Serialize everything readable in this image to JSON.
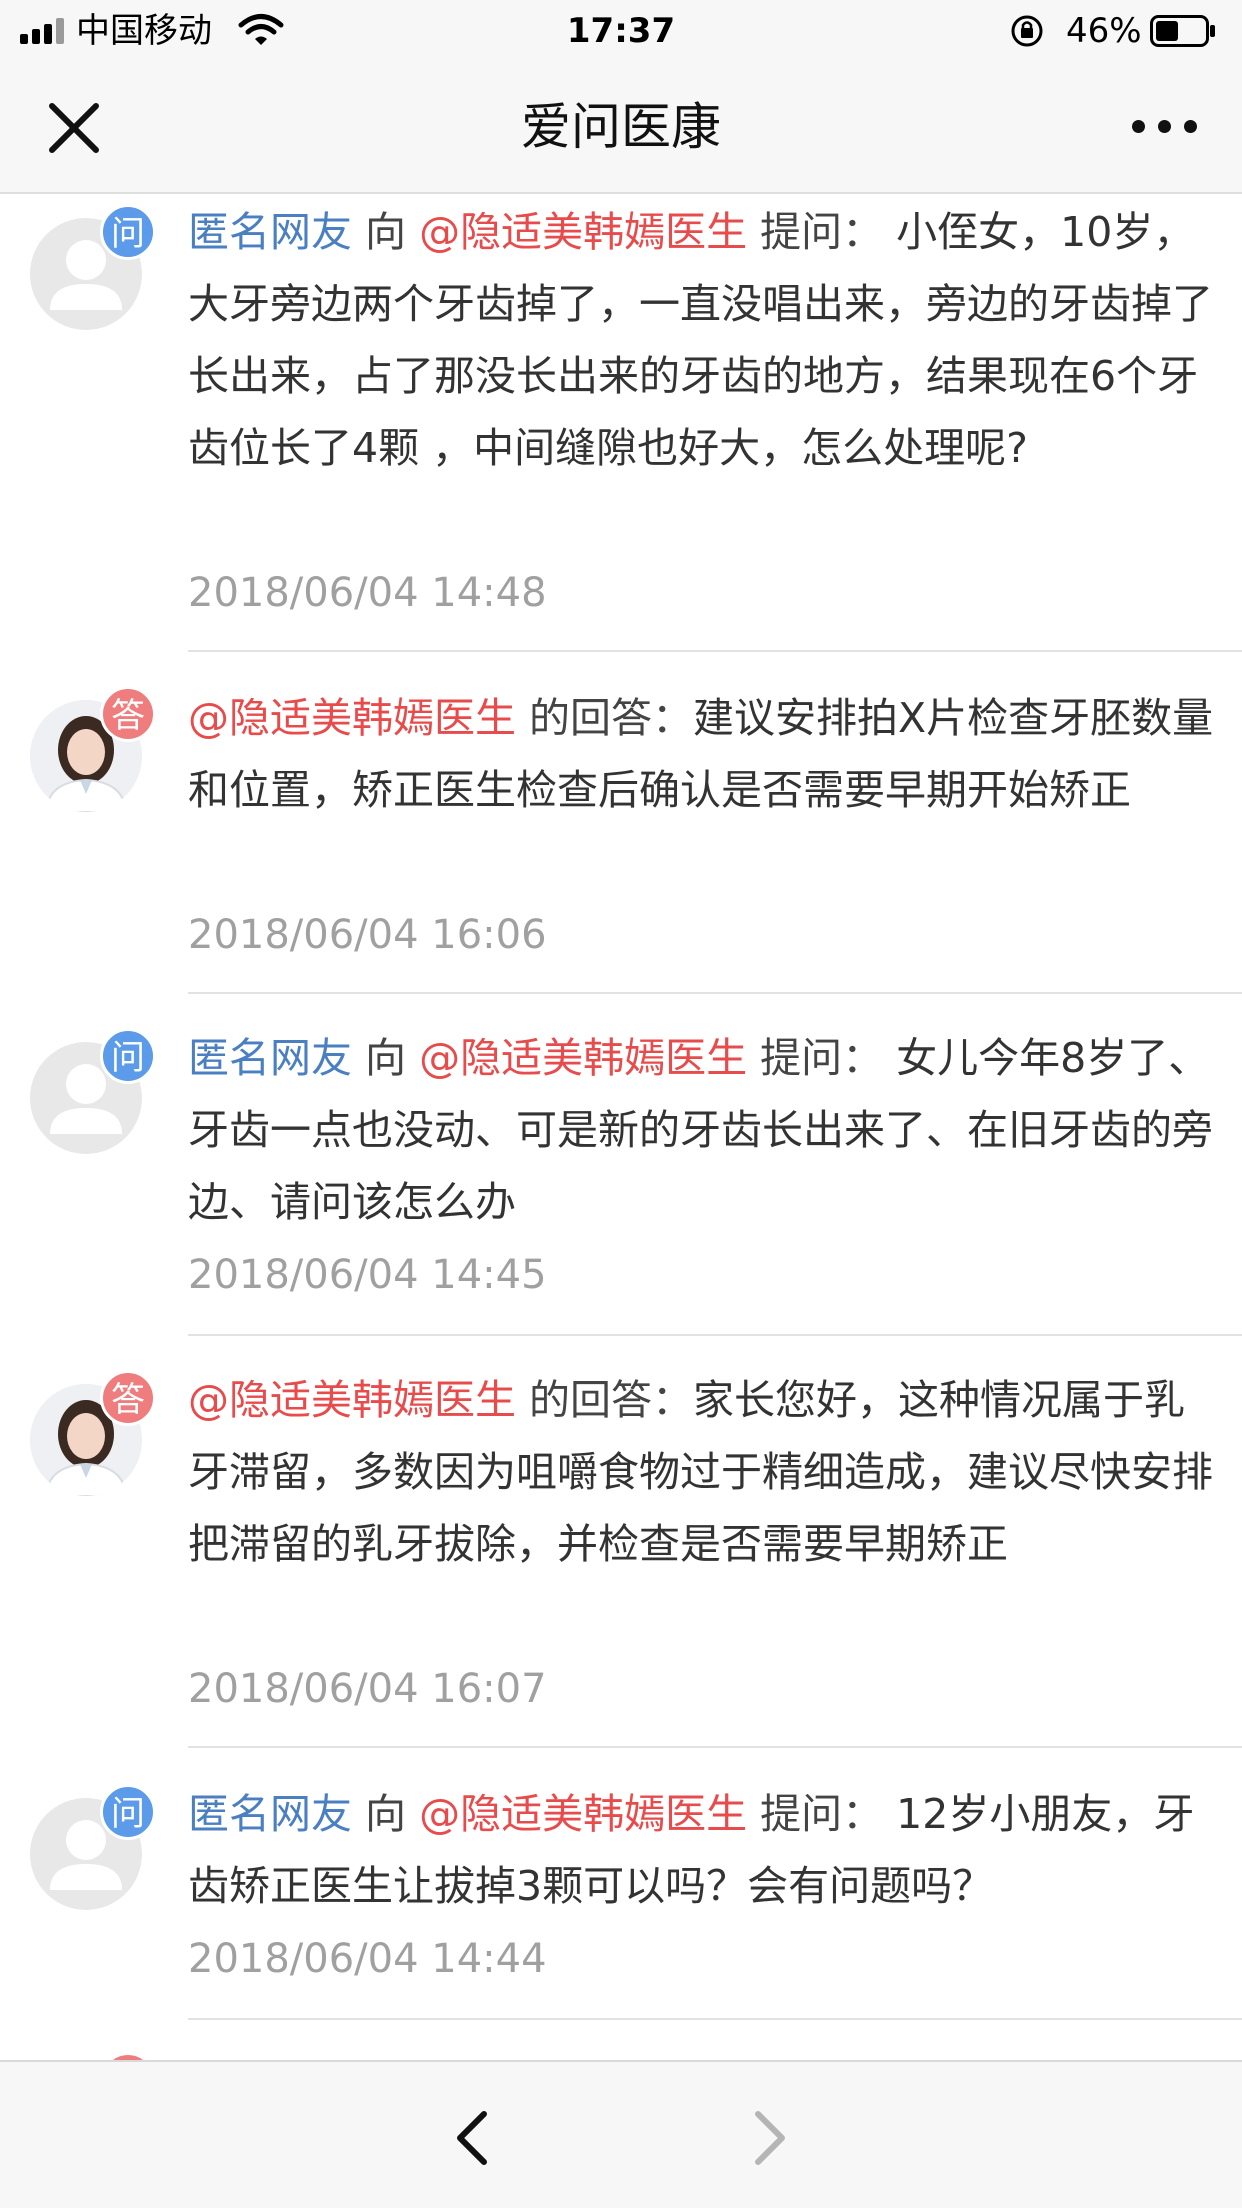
{
  "status_bar": {
    "carrier": "中国移动",
    "time": "17:37",
    "battery_percent": "46%",
    "battery_level": 0.46
  },
  "nav": {
    "title": "爱问医康"
  },
  "items": [
    {
      "type": "question",
      "badge": "问",
      "asker": "匿名网友",
      "to_word": " 向 ",
      "doctor": "@隐适美韩嫣医生",
      "label": " 提问： ",
      "text": "小侄女，10岁，大牙旁边两个牙齿掉了，一直没唱出来，旁边的牙齿掉了长出来，占了那没长出来的牙齿的地方，结果现在6个牙齿位长了4颗 ，中间缝隙也好大，怎么处理呢?",
      "time": "2018/06/04 14:48"
    },
    {
      "type": "answer",
      "badge": "答",
      "doctor": "@隐适美韩嫣医生",
      "label": " 的回答：",
      "text": "建议安排拍X片检查牙胚数量和位置，矫正医生检查后确认是否需要早期开始矫正",
      "time": "2018/06/04 16:06"
    },
    {
      "type": "question",
      "badge": "问",
      "asker": "匿名网友",
      "to_word": " 向 ",
      "doctor": "@隐适美韩嫣医生",
      "label": " 提问： ",
      "text": "女儿今年8岁了、牙齿一点也没动、可是新的牙齿长出来了、在旧牙齿的旁边、请问该怎么办",
      "time": "2018/06/04 14:45"
    },
    {
      "type": "answer",
      "badge": "答",
      "doctor": "@隐适美韩嫣医生",
      "label": " 的回答：",
      "text": "家长您好，这种情况属于乳牙滞留，多数因为咀嚼食物过于精细造成，建议尽快安排把滞留的乳牙拔除，并检查是否需要早期矫正",
      "time": "2018/06/04 16:07"
    },
    {
      "type": "question",
      "badge": "问",
      "asker": "匿名网友",
      "to_word": " 向 ",
      "doctor": "@隐适美韩嫣医生",
      "label": " 提问： ",
      "text": "12岁小朋友，牙齿矫正医生让拔掉3颗可以吗？会有问题吗？",
      "time": "2018/06/04 14:44"
    }
  ]
}
